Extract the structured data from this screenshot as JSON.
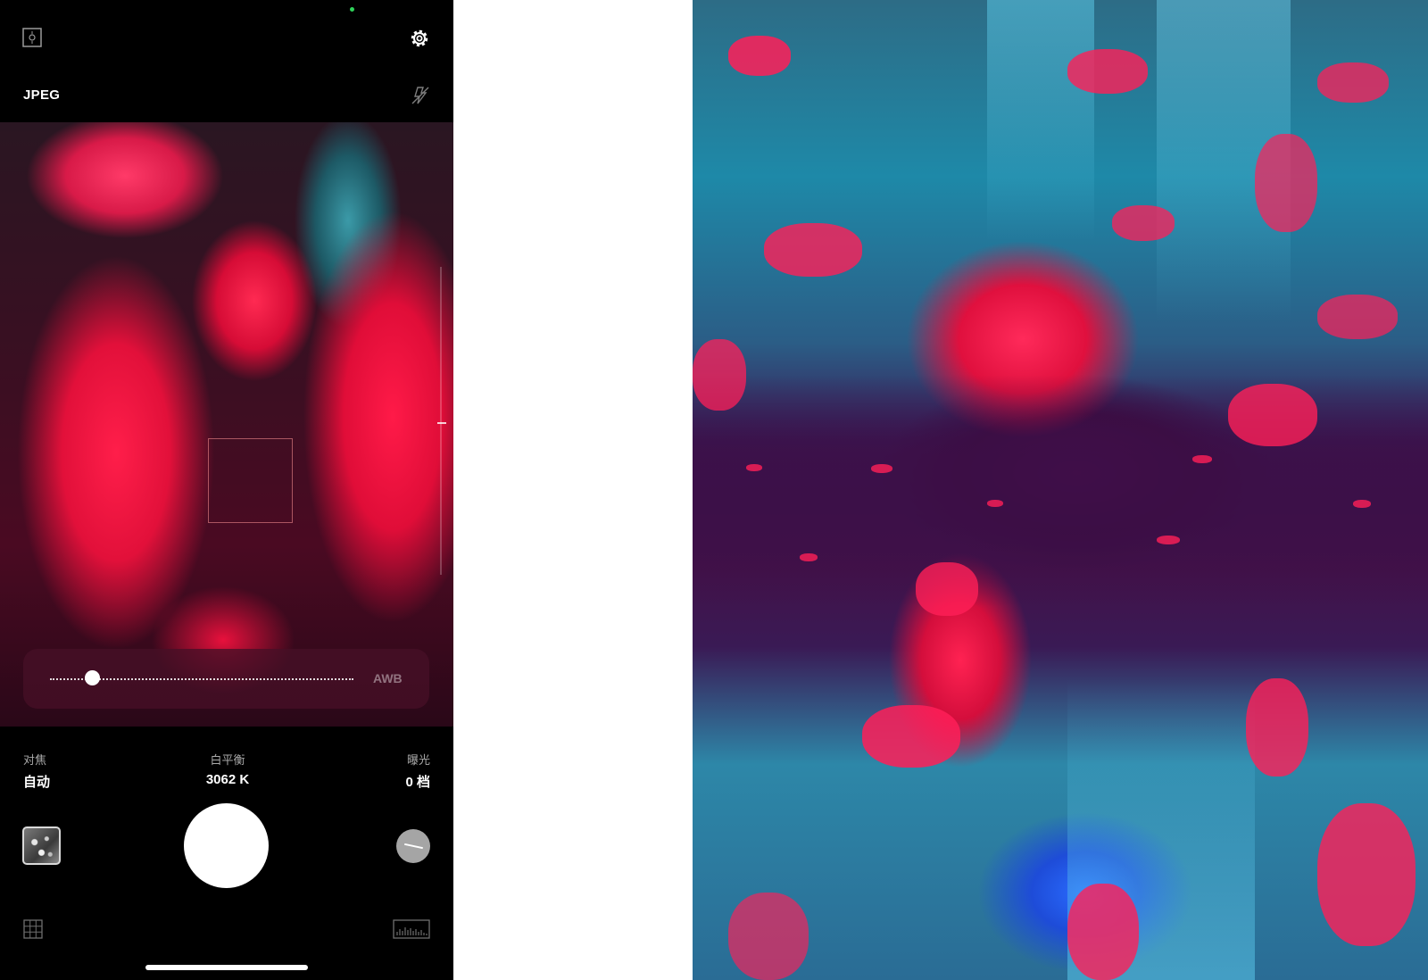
{
  "camera": {
    "format": "JPEG",
    "white_balance_mode": "AWB",
    "white_balance_slider": 0.14,
    "focus": {
      "label": "对焦",
      "value": "自动"
    },
    "white_balance": {
      "label": "白平衡",
      "value": "3062 K"
    },
    "exposure": {
      "label": "曝光",
      "value": "0 档"
    },
    "icons": {
      "top_left": "viewfinder-frame-icon",
      "settings": "gear-icon",
      "flash": "flash-off-icon",
      "grid": "grid-icon",
      "histogram": "histogram-icon"
    },
    "colors": {
      "accent_green": "#2fd35a",
      "background": "#000000"
    }
  }
}
